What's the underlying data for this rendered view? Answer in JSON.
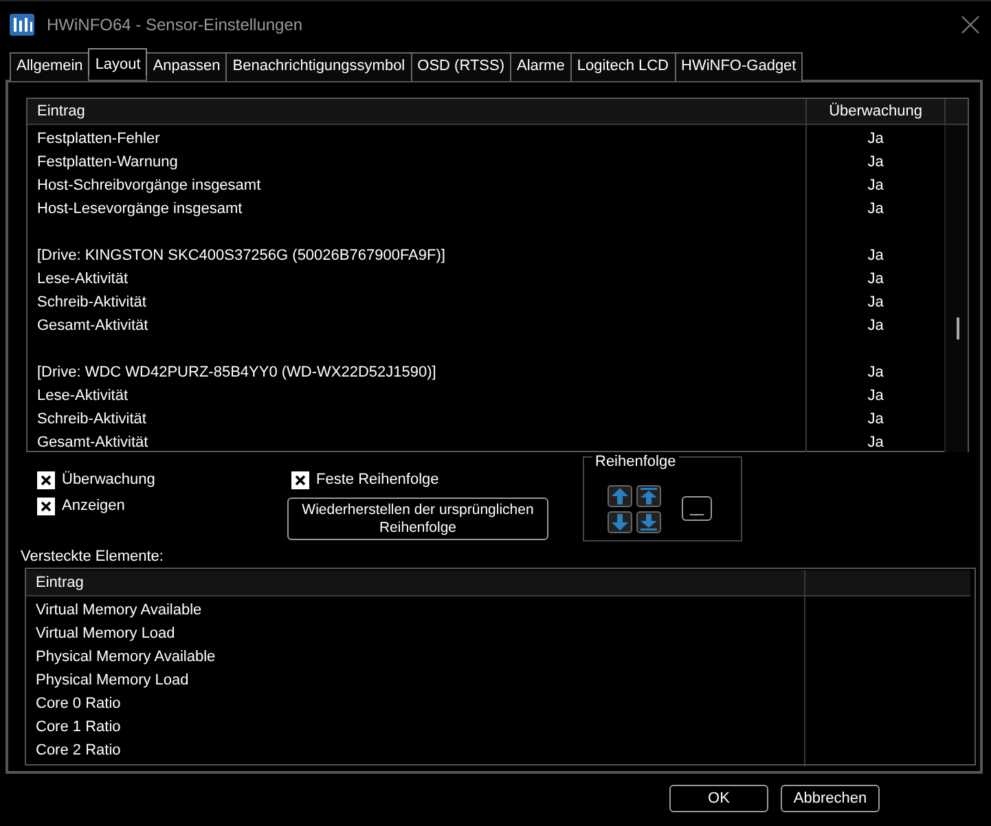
{
  "window": {
    "title": "HWiNFO64 - Sensor-Einstellungen"
  },
  "tabs": [
    {
      "label": "Allgemein",
      "selected": false
    },
    {
      "label": "Layout",
      "selected": true
    },
    {
      "label": "Anpassen",
      "selected": false
    },
    {
      "label": "Benachrichtigungssymbol",
      "selected": false
    },
    {
      "label": "OSD (RTSS)",
      "selected": false
    },
    {
      "label": "Alarme",
      "selected": false
    },
    {
      "label": "Logitech LCD",
      "selected": false
    },
    {
      "label": "HWiNFO-Gadget",
      "selected": false
    }
  ],
  "sensor_table": {
    "columns": [
      "Eintrag",
      "Überwachung"
    ],
    "rows": [
      {
        "kind": "item",
        "entry": "Festplatten-Fehler",
        "monitoring": "Ja"
      },
      {
        "kind": "item",
        "entry": "Festplatten-Warnung",
        "monitoring": "Ja"
      },
      {
        "kind": "item",
        "entry": "Host-Schreibvorgänge insgesamt",
        "monitoring": "Ja"
      },
      {
        "kind": "item",
        "entry": "Host-Lesevorgänge insgesamt",
        "monitoring": "Ja"
      },
      {
        "kind": "spacer"
      },
      {
        "kind": "item",
        "entry": "[Drive: KINGSTON SKC400S37256G (50026B767900FA9F)]",
        "monitoring": "Ja"
      },
      {
        "kind": "item",
        "entry": "Lese-Aktivität",
        "monitoring": "Ja"
      },
      {
        "kind": "item",
        "entry": "Schreib-Aktivität",
        "monitoring": "Ja"
      },
      {
        "kind": "item",
        "entry": "Gesamt-Aktivität",
        "monitoring": "Ja"
      },
      {
        "kind": "spacer"
      },
      {
        "kind": "item",
        "entry": "[Drive: WDC WD42PURZ-85B4YY0 (WD-WX22D52J1590)]",
        "monitoring": "Ja"
      },
      {
        "kind": "item",
        "entry": "Lese-Aktivität",
        "monitoring": "Ja"
      },
      {
        "kind": "item",
        "entry": "Schreib-Aktivität",
        "monitoring": "Ja"
      },
      {
        "kind": "item",
        "entry": "Gesamt-Aktivität",
        "monitoring": "Ja"
      }
    ]
  },
  "options": [
    {
      "label": "Überwachung",
      "checked": true
    },
    {
      "label": "Anzeigen",
      "checked": true
    }
  ],
  "fixed_order": {
    "label": "Feste Reihenfolge",
    "checked": true
  },
  "restore_button": "Wiederherstellen der ursprünglichen Reihenfolge",
  "order_group": {
    "title": "Reihenfolge",
    "reset_key": "__"
  },
  "hidden_label": "Versteckte Elemente:",
  "hidden_table": {
    "columns": [
      "Eintrag"
    ],
    "rows": [
      "Virtual Memory Available",
      "Virtual Memory Load",
      "Physical Memory Available",
      "Physical Memory Load",
      "Core 0 Ratio",
      "Core 1 Ratio",
      "Core 2 Ratio"
    ]
  },
  "buttons": [
    "OK",
    "Abbrechen"
  ]
}
